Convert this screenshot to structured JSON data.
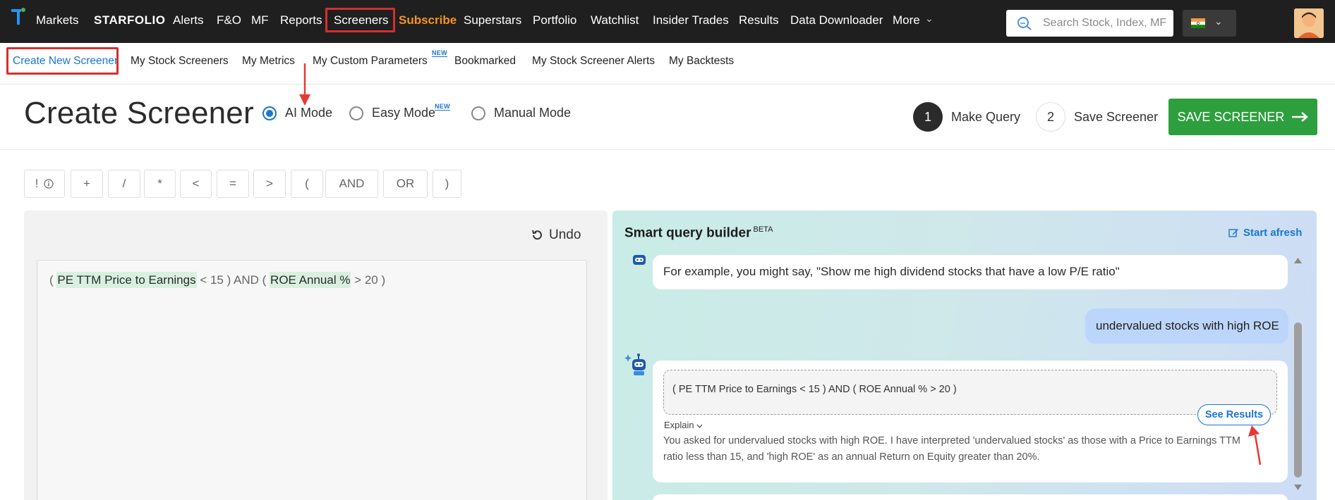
{
  "topnav": {
    "items": [
      "Markets",
      "STARFOLIO",
      "Alerts",
      "F&O",
      "MF",
      "Reports",
      "Screeners",
      "Subscribe",
      "Superstars",
      "Portfolio",
      "Watchlist",
      "Insider Trades",
      "Results",
      "Data Downloader",
      "More"
    ],
    "more_chevron": "⌄",
    "search_placeholder": "Search Stock, Index, MF",
    "country_chevron": "⌄",
    "subscribe_color": "#f7941d"
  },
  "subnav": {
    "items": [
      "Create New Screener",
      "My Stock Screeners",
      "My Metrics",
      "My Custom Parameters",
      "Bookmarked",
      "My Stock Screener Alerts",
      "My Backtests"
    ],
    "new_badge": "NEW"
  },
  "header": {
    "title": "Create Screener",
    "modes": [
      {
        "label": "AI Mode",
        "checked": true
      },
      {
        "label": "Easy Mode",
        "checked": false,
        "badge": "NEW"
      },
      {
        "label": "Manual Mode",
        "checked": false
      }
    ],
    "steps": [
      {
        "num": "1",
        "label": "Make Query",
        "active": true
      },
      {
        "num": "2",
        "label": "Save Screener",
        "active": false
      }
    ],
    "save_button": "SAVE SCREENER",
    "save_color": "#2e9f3e"
  },
  "operators": [
    "!",
    "+",
    "/",
    "*",
    "<",
    "=",
    ">",
    "(",
    "AND",
    "OR",
    ")"
  ],
  "editor": {
    "undo": "Undo",
    "query": [
      {
        "t": "( ",
        "tok": false
      },
      {
        "t": "PE TTM Price to Earnings",
        "tok": true
      },
      {
        "t": " < 15 ) AND ( ",
        "tok": false
      },
      {
        "t": "ROE Annual %",
        "tok": true
      },
      {
        "t": " > 20 )",
        "tok": false
      }
    ]
  },
  "smart": {
    "title": "Smart query builder",
    "beta": "BETA",
    "start_afresh": "Start afresh",
    "example_message": "For example, you might say, \"Show me high dividend stocks that have a low P/E ratio\"",
    "user_message": "undervalued stocks with high ROE",
    "generated_query": "( PE TTM Price to Earnings < 15 ) AND ( ROE Annual % > 20 )",
    "see_results": "See Results",
    "explain_label": "Explain",
    "explain_text": "You asked for undervalued stocks with high ROE. I have interpreted 'undervalued stocks' as those with a Price to Earnings TTM ratio less than 15, and 'high ROE' as an annual Return on Equity greater than 20%."
  },
  "colors": {
    "accent": "#1976d2",
    "highlight_box": "#d32f2f",
    "token_bg": "#d9f0df",
    "user_bubble": "#bcd6fb"
  }
}
